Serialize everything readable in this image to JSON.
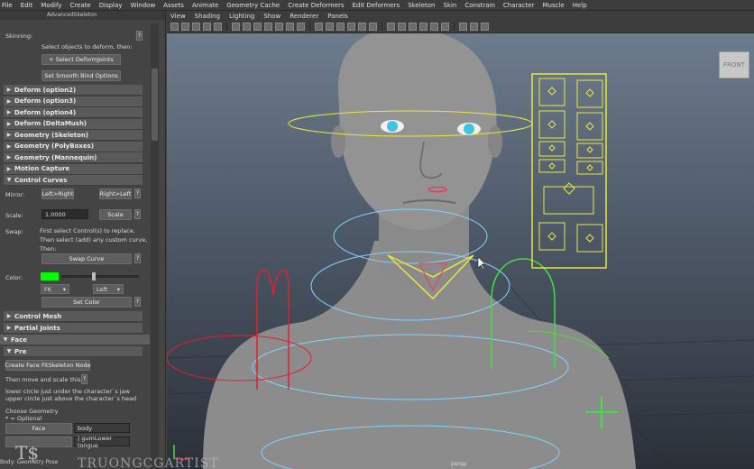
{
  "menubar": [
    "File",
    "Edit",
    "Modify",
    "Create",
    "Display",
    "Window",
    "Assets",
    "Animate",
    "Geometry Cache",
    "Create Deformers",
    "Edit Deformers",
    "Skeleton",
    "Skin",
    "Constrain",
    "Character",
    "Muscle",
    "Help"
  ],
  "panel": {
    "title": "AdvancedSkeleton",
    "skinning_label": "Skinning:",
    "skinning_help": "Select objects to deform, then:",
    "select_joints_btn": "+ Select DeformJoints",
    "smooth_bind_btn": "Set Smooth Bind Options",
    "frames": [
      "Deform    (option2)",
      "Deform    (option3)",
      "Deform    (option4)",
      "Deform    (DeltaMush)",
      "Geometry (Skeleton)",
      "Geometry (PolyBoxes)",
      "Geometry (Mannequin)",
      "Motion Capture"
    ],
    "control_curves": "Control Curves",
    "mirror_label": "Mirror:",
    "left_right_btn": "Left>Right",
    "right_left_btn": "Right>Left",
    "scale_label": "Scale:",
    "scale_value": "1.0000",
    "scale_btn": "Scale",
    "swap_label": "Swap:",
    "swap_help": [
      "First select Control(s) to replace,",
      "Then select (add) any custom curve,",
      "Then:"
    ],
    "swap_btn": "Swap Curve",
    "color_label": "Color:",
    "color_value": "#00ff00",
    "color_drop1": "FK",
    "color_drop2": "Left",
    "set_color_btn": "Set Color",
    "control_mesh": "Control Mesh",
    "partial_joints": "Partial Joints",
    "face": "Face",
    "pre": "Pre",
    "create_face_btn": "Create Face FitSkeleton Node",
    "move_scale_text": "Then move and scale this:",
    "jaw_text": [
      "lower circle just under the character`s jaw",
      "upper circle just above the character`s head"
    ],
    "choose_geometry": "Choose Geometry",
    "optional": "* = Optional",
    "face_btn": "Face",
    "face_value": "body",
    "gum_value": "| gumLower tongue",
    "q": "?"
  },
  "viewport": {
    "menu": [
      "View",
      "Shading",
      "Lighting",
      "Show",
      "Renderer",
      "Panels"
    ],
    "cube_label": "FRONT",
    "camera_label": "persp"
  },
  "status_text": "Body: Geometry Pose",
  "watermark": "TRUONGCGARTIST",
  "logo": "T$"
}
